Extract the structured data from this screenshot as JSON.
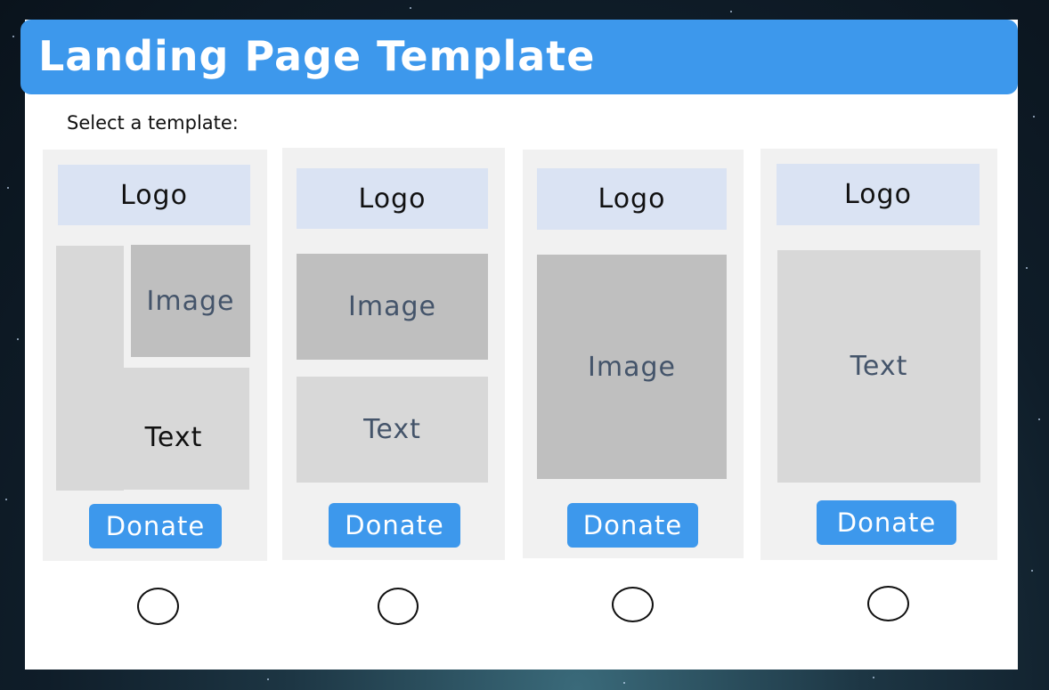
{
  "window": {
    "title": "Landing Page Template"
  },
  "prompt": "Select a template:",
  "templates": [
    {
      "logo": "Logo",
      "image": "Image",
      "text": "Text",
      "button": "Donate",
      "selected": false
    },
    {
      "logo": "Logo",
      "image": "Image",
      "text": "Text",
      "button": "Donate",
      "selected": false
    },
    {
      "logo": "Logo",
      "image": "Image",
      "button": "Donate",
      "selected": false
    },
    {
      "logo": "Logo",
      "text": "Text",
      "button": "Donate",
      "selected": false
    }
  ],
  "colors": {
    "accent": "#3d98ec",
    "logo_block": "#dae3f3",
    "image_block": "#bfbfbf",
    "text_block": "#d8d8d8",
    "card": "#f1f1f1"
  }
}
